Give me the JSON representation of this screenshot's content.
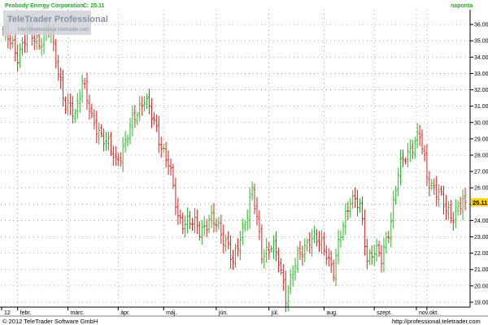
{
  "header": {
    "instrument_label": "Peabody Energy Corporation",
    "last_close_label": "C: 25.11",
    "period_label": "naponta"
  },
  "watermark": {
    "brand": "TeleTrader Professional",
    "url": "http://professional.teletrader.com"
  },
  "footer": {
    "copyright": "© 2012 TeleTrader Software GmbH",
    "url": "http://professional.teletrader.com"
  },
  "colors": {
    "up": "#22bb22",
    "down": "#dd2222",
    "header_text": "#22aa22",
    "grid_dot": "#9a9a9a",
    "price_badge_bg": "#ffd400"
  },
  "chart_data": {
    "type": "ohlc",
    "title": "Peabody Energy Corporation",
    "last_close": 25.11,
    "price_tag": "25.11",
    "interval": "naponta",
    "y_axis_side": "right",
    "ylim": [
      18.7,
      36.9
    ],
    "y_ticks": [
      "19.00",
      "20.00",
      "21.00",
      "22.00",
      "23.00",
      "24.00",
      "25.00",
      "26.00",
      "27.00",
      "28.00",
      "29.00",
      "30.00",
      "31.00",
      "32.00",
      "33.00",
      "34.00",
      "35.00",
      "36.00"
    ],
    "x_tick_labels": [
      "12",
      "febr.",
      "márc.",
      "ápr.",
      "máj.",
      "jún.",
      "júl.",
      "aug.",
      "szept.",
      "okt.",
      "nov."
    ],
    "grid": "dotted",
    "anchors": [
      [
        0,
        35.5
      ],
      [
        6,
        34.2
      ],
      [
        10,
        35.4
      ],
      [
        15,
        35.0
      ],
      [
        19,
        35.6
      ],
      [
        22,
        34.0
      ],
      [
        26,
        31.0
      ],
      [
        30,
        30.4
      ],
      [
        33,
        32.8
      ],
      [
        37,
        30.0
      ],
      [
        42,
        29.2
      ],
      [
        47,
        27.5
      ],
      [
        51,
        28.9
      ],
      [
        56,
        30.6
      ],
      [
        59,
        31.7
      ],
      [
        64,
        29.4
      ],
      [
        69,
        27.6
      ],
      [
        73,
        24.1
      ],
      [
        77,
        24.0
      ],
      [
        82,
        23.4
      ],
      [
        86,
        24.1
      ],
      [
        90,
        23.5
      ],
      [
        94,
        22.6
      ],
      [
        96,
        21.2
      ],
      [
        101,
        24.1
      ],
      [
        104,
        25.8
      ],
      [
        108,
        22.0
      ],
      [
        112,
        22.5
      ],
      [
        115,
        21.4
      ],
      [
        118,
        19.5
      ],
      [
        120,
        20.4
      ],
      [
        123,
        21.6
      ],
      [
        128,
        23.0
      ],
      [
        131,
        22.7
      ],
      [
        135,
        22.2
      ],
      [
        138,
        20.8
      ],
      [
        142,
        23.8
      ],
      [
        145,
        25.5
      ],
      [
        149,
        24.7
      ],
      [
        152,
        21.8
      ],
      [
        155,
        22.2
      ],
      [
        158,
        21.5
      ],
      [
        162,
        24.2
      ],
      [
        165,
        26.8
      ],
      [
        168,
        28.0
      ],
      [
        171,
        28.7
      ],
      [
        174,
        29.1
      ],
      [
        177,
        26.8
      ],
      [
        180,
        26.0
      ],
      [
        185,
        24.7
      ],
      [
        188,
        24.4
      ],
      [
        190,
        24.7
      ],
      [
        193,
        25.11
      ]
    ]
  }
}
